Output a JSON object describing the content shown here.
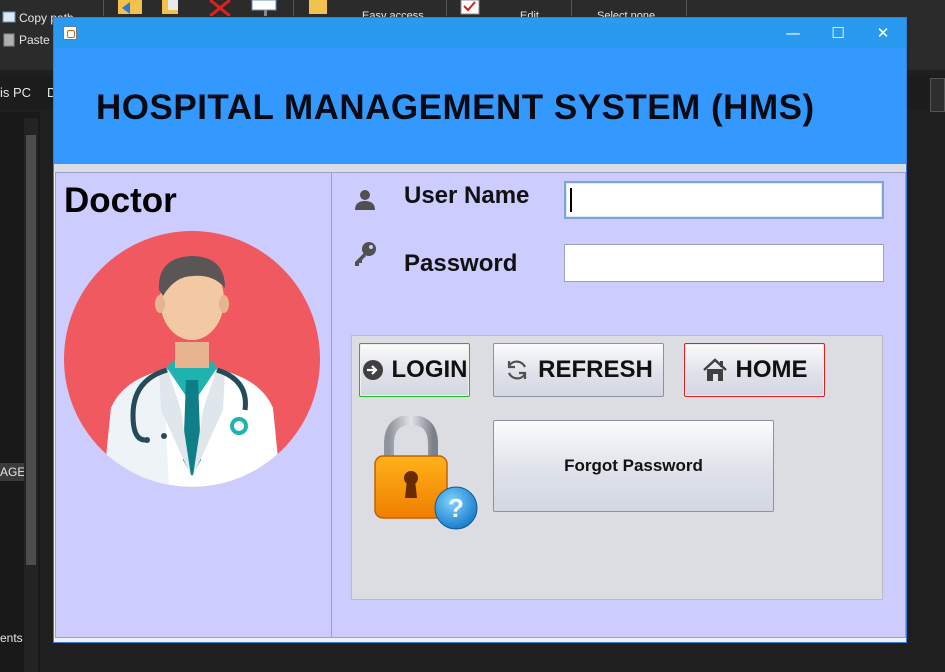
{
  "background": {
    "ribbon_items": [
      "Copy path",
      "Paste s",
      "Easy access",
      "Edit",
      "Select none"
    ],
    "address_text": "is PC",
    "address_text2": "D",
    "nav_item": "AGEM",
    "nav_item2": "ents"
  },
  "window": {
    "minimize_label": "—",
    "maximize_label": "☐",
    "close_label": "✕"
  },
  "header": {
    "title": "HOSPITAL MANAGEMENT SYSTEM (HMS)"
  },
  "left_panel": {
    "role_label": "Doctor",
    "avatar_icon": "doctor-avatar"
  },
  "form": {
    "username": {
      "label": "User Name",
      "value": "",
      "placeholder": "",
      "icon": "user-icon"
    },
    "password": {
      "label": "Password",
      "value": "",
      "placeholder": "",
      "icon": "key-icon"
    }
  },
  "actions": {
    "login_label": "LOGIN",
    "refresh_label": "REFRESH",
    "home_label": "HOME",
    "forgot_label": "Forgot Password",
    "lock_icon": "lock-help-icon"
  },
  "colors": {
    "header_bg": "#3399ff",
    "titlebar_bg": "#2a9af0",
    "panel_bg": "#ccccff",
    "login_border": "#22b822",
    "home_border": "#e02020"
  }
}
